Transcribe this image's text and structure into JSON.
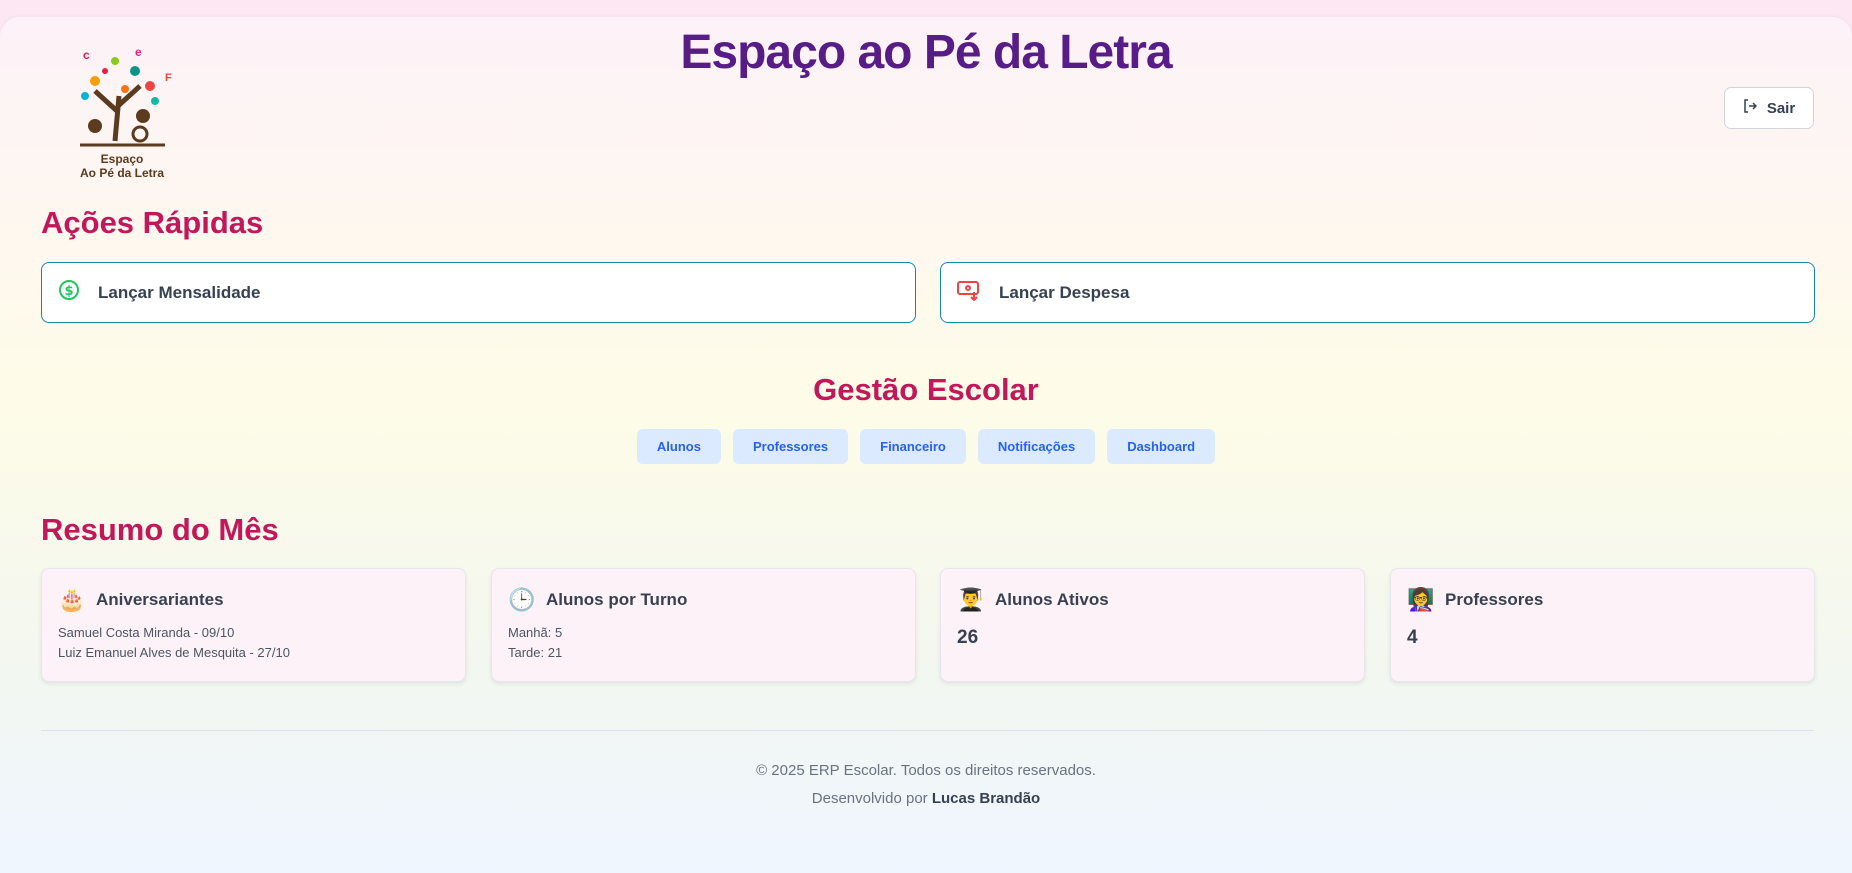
{
  "header": {
    "title": "Espaço ao Pé da Letra",
    "logo_text": "Espaço Ao Pé da Letra",
    "logout_label": "Sair"
  },
  "quick_actions": {
    "title": "Ações Rápidas",
    "items": [
      {
        "label": "Lançar Mensalidade",
        "icon": "dollar-circle-icon",
        "color": "#22c55e"
      },
      {
        "label": "Lançar Despesa",
        "icon": "money-out-icon",
        "color": "#ef4444"
      }
    ]
  },
  "management": {
    "title": "Gestão Escolar",
    "items": [
      "Alunos",
      "Professores",
      "Financeiro",
      "Notificações",
      "Dashboard"
    ]
  },
  "summary": {
    "title": "Resumo do Mês",
    "birthdays": {
      "title": "Aniversariantes",
      "icon": "cake-icon",
      "items": [
        "Samuel Costa Miranda - 09/10",
        "Luiz Emanuel Alves de Mesquita - 27/10"
      ]
    },
    "shifts": {
      "title": "Alunos por Turno",
      "icon": "clock-icon",
      "items": [
        "Manhã: 5",
        "Tarde: 21"
      ]
    },
    "active_students": {
      "title": "Alunos Ativos",
      "icon": "student-icon",
      "value": "26"
    },
    "teachers": {
      "title": "Professores",
      "icon": "teacher-icon",
      "value": "4"
    }
  },
  "footer": {
    "copyright": "© 2025 ERP Escolar. Todos os direitos reservados.",
    "developed_by": "Desenvolvido por",
    "author": "Lucas Brandão"
  }
}
